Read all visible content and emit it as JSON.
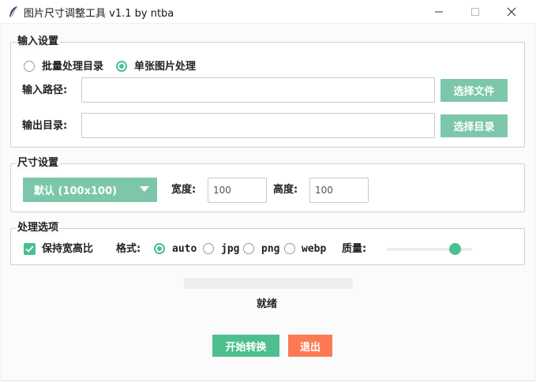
{
  "window": {
    "title": "图片尺寸调整工具 v1.1 by ntba",
    "minimize_icon": "minimize-icon",
    "maximize_icon": "maximize-icon",
    "close_icon": "close-icon"
  },
  "input_settings": {
    "legend": "输入设置",
    "mode_batch": "批量处理目录",
    "mode_single": "单张图片处理",
    "selected_mode": "single",
    "input_path_label": "输入路径:",
    "input_path_value": "",
    "choose_file_button": "选择文件",
    "output_dir_label": "输出目录:",
    "output_dir_value": "",
    "choose_dir_button": "选择目录"
  },
  "size_settings": {
    "legend": "尺寸设置",
    "preset_value": "默认 (100x100)",
    "width_label": "宽度:",
    "width_value": "100",
    "height_label": "高度:",
    "height_value": "100"
  },
  "options": {
    "legend": "处理选项",
    "keep_ratio_label": "保持宽高比",
    "keep_ratio_checked": true,
    "format_label": "格式:",
    "formats": [
      "auto",
      "jpg",
      "png",
      "webp"
    ],
    "selected_format": "auto",
    "quality_label": "质量:",
    "quality_fraction": 0.8
  },
  "progress_fraction": 0,
  "status_text": "就绪",
  "actions": {
    "start_button": "开始转换",
    "exit_button": "退出"
  },
  "colors": {
    "accent": "#4bbf90",
    "button_teal": "#7cc7aa",
    "exit_red": "#fb7a54"
  }
}
